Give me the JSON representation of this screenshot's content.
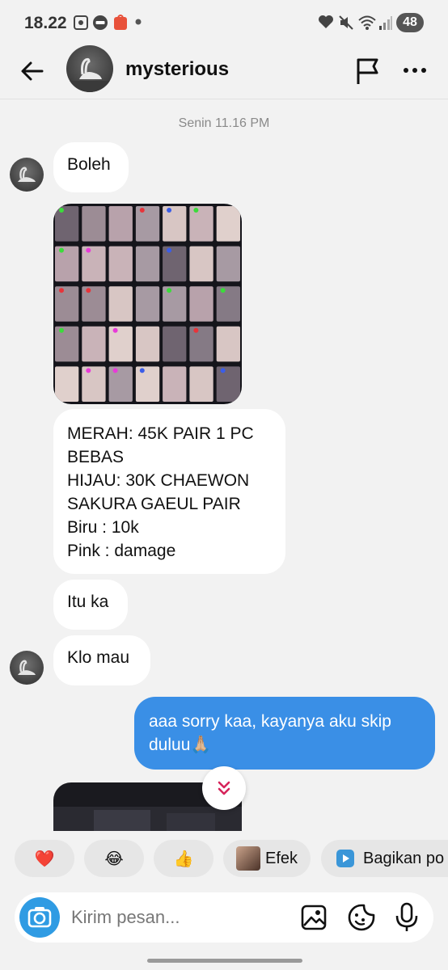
{
  "status_bar": {
    "time": "18.22",
    "battery": "48"
  },
  "header": {
    "name": "mysterious"
  },
  "chat": {
    "timestamp": "Senin 11.16 PM",
    "messages": [
      {
        "text": "Boleh"
      },
      {
        "lines": [
          "MERAH: 45K PAIR 1 PC",
          "BEBAS",
          "HIJAU: 30K CHAEWON",
          "SAKURA GAEUL PAIR",
          "Biru : 10k",
          "Pink : damage"
        ]
      },
      {
        "text": "Itu ka"
      },
      {
        "text": "Klo mau"
      },
      {
        "text": "aaa sorry kaa, kayanya aku skip duluu🙏🏼"
      }
    ]
  },
  "quick_reactions": {
    "heart": "❤️",
    "laugh": "😂",
    "thumbs": "👍",
    "efek_label": "Efek",
    "share_label": "Bagikan po"
  },
  "composer": {
    "placeholder": "Kirim pesan..."
  }
}
